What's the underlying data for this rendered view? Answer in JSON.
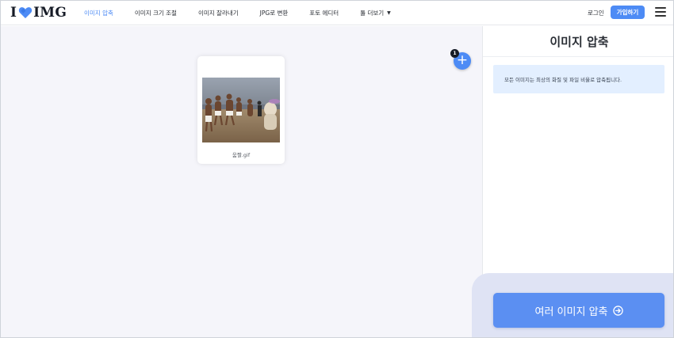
{
  "header": {
    "logo_prefix": "I",
    "logo_suffix": "IMG",
    "nav": [
      {
        "label": "이미지 압축",
        "active": true
      },
      {
        "label": "이미지 크기 조절",
        "active": false
      },
      {
        "label": "이미지 잘라내기",
        "active": false
      },
      {
        "label": "JPG로 변환",
        "active": false
      },
      {
        "label": "포토 에디터",
        "active": false
      },
      {
        "label": "툴 더보기",
        "active": false,
        "caret": "▼"
      }
    ],
    "login_label": "로그인",
    "signup_label": "가입하기"
  },
  "workspace": {
    "file_count": "1",
    "add_icon": "+",
    "files": [
      {
        "name": "움짤.gif",
        "thumbnail": "beach-dance-scene"
      }
    ]
  },
  "sidebar": {
    "title": "이미지 압축",
    "info": "모든 이미지는 최상의 화질 및 파일 비율로 압축됩니다.",
    "action_label": "여러 이미지 압축"
  },
  "colors": {
    "accent": "#4d8bf5",
    "workspace_bg": "#f5f5fa",
    "info_bg": "#e3efff",
    "action_button": "#5b8ff2",
    "bottom_panel": "#dfe3f4"
  }
}
